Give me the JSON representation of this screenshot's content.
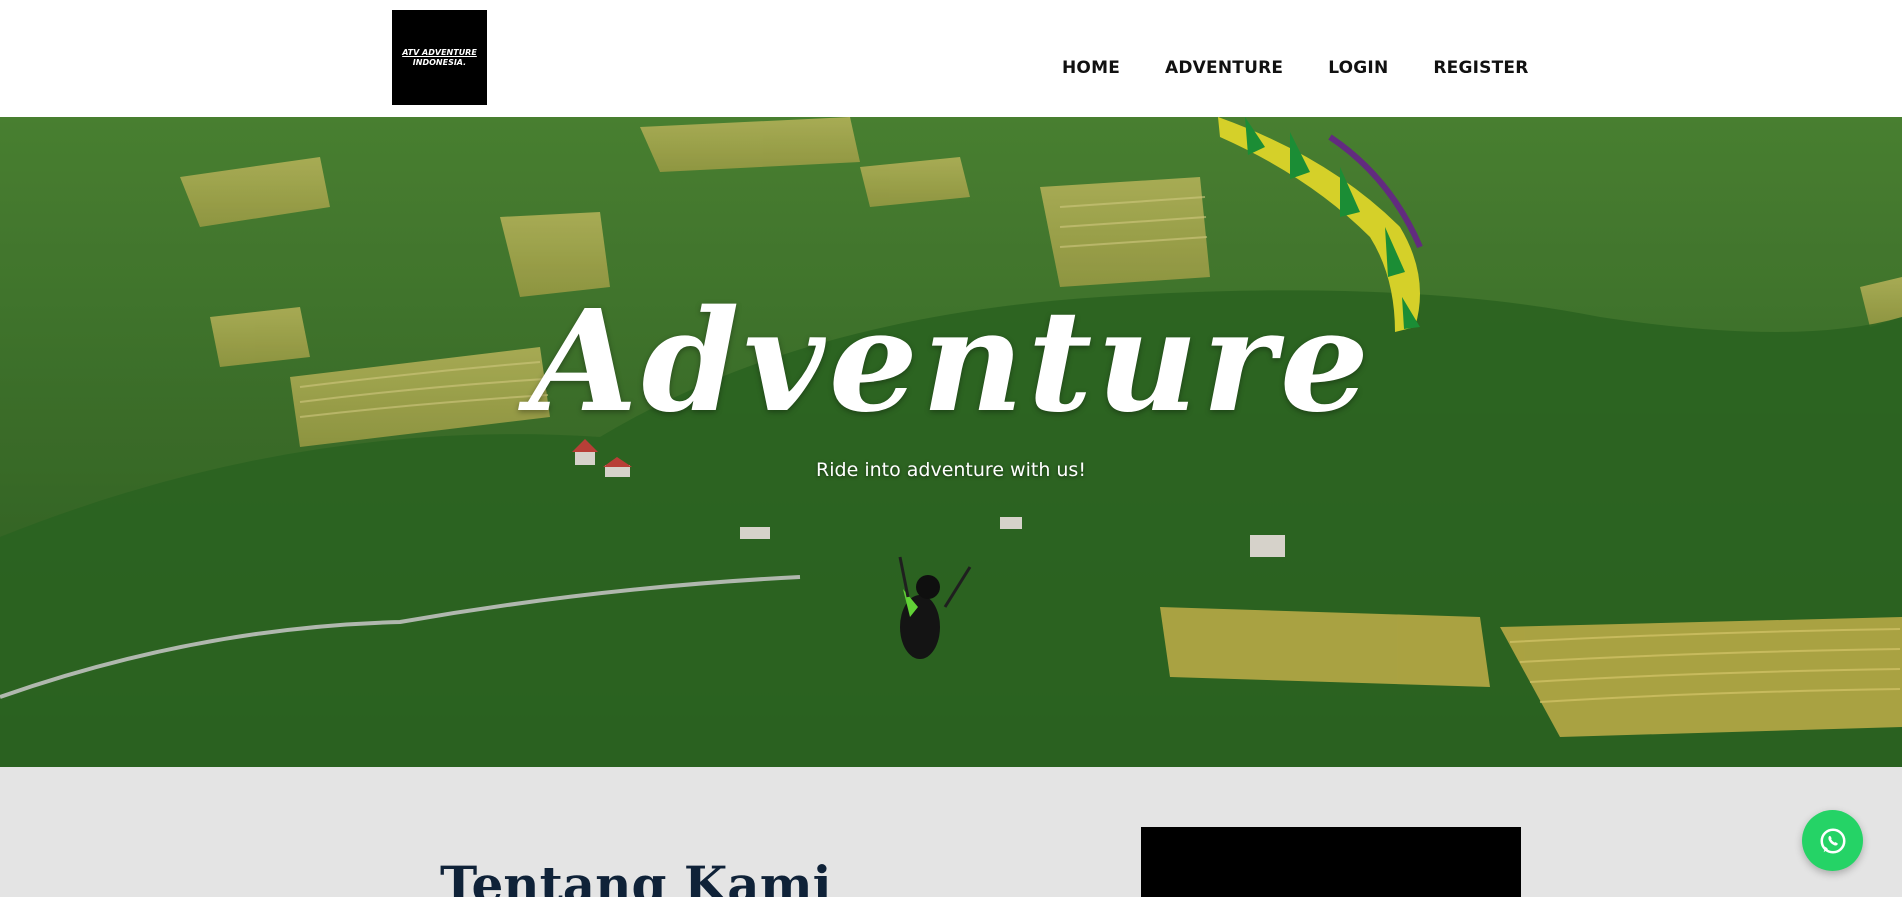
{
  "brand": {
    "logo_line1": "ATV ADVENTURE",
    "logo_line2": "INDONESIA."
  },
  "nav": {
    "items": [
      {
        "label": "HOME"
      },
      {
        "label": "ADVENTURE"
      },
      {
        "label": "LOGIN"
      },
      {
        "label": "REGISTER"
      }
    ]
  },
  "hero": {
    "title": "Adventure",
    "subtitle": "Ride into adventure with us!",
    "image_icon": "paragliding-landscape-image"
  },
  "about": {
    "title": "Tentang Kami"
  },
  "floating": {
    "whatsapp_icon": "whatsapp-icon",
    "whatsapp_color": "#25d366"
  },
  "colors": {
    "header_bg": "#ffffff",
    "nav_text": "#111111",
    "about_bg": "#e4e4e4",
    "about_title": "#0f2238"
  }
}
